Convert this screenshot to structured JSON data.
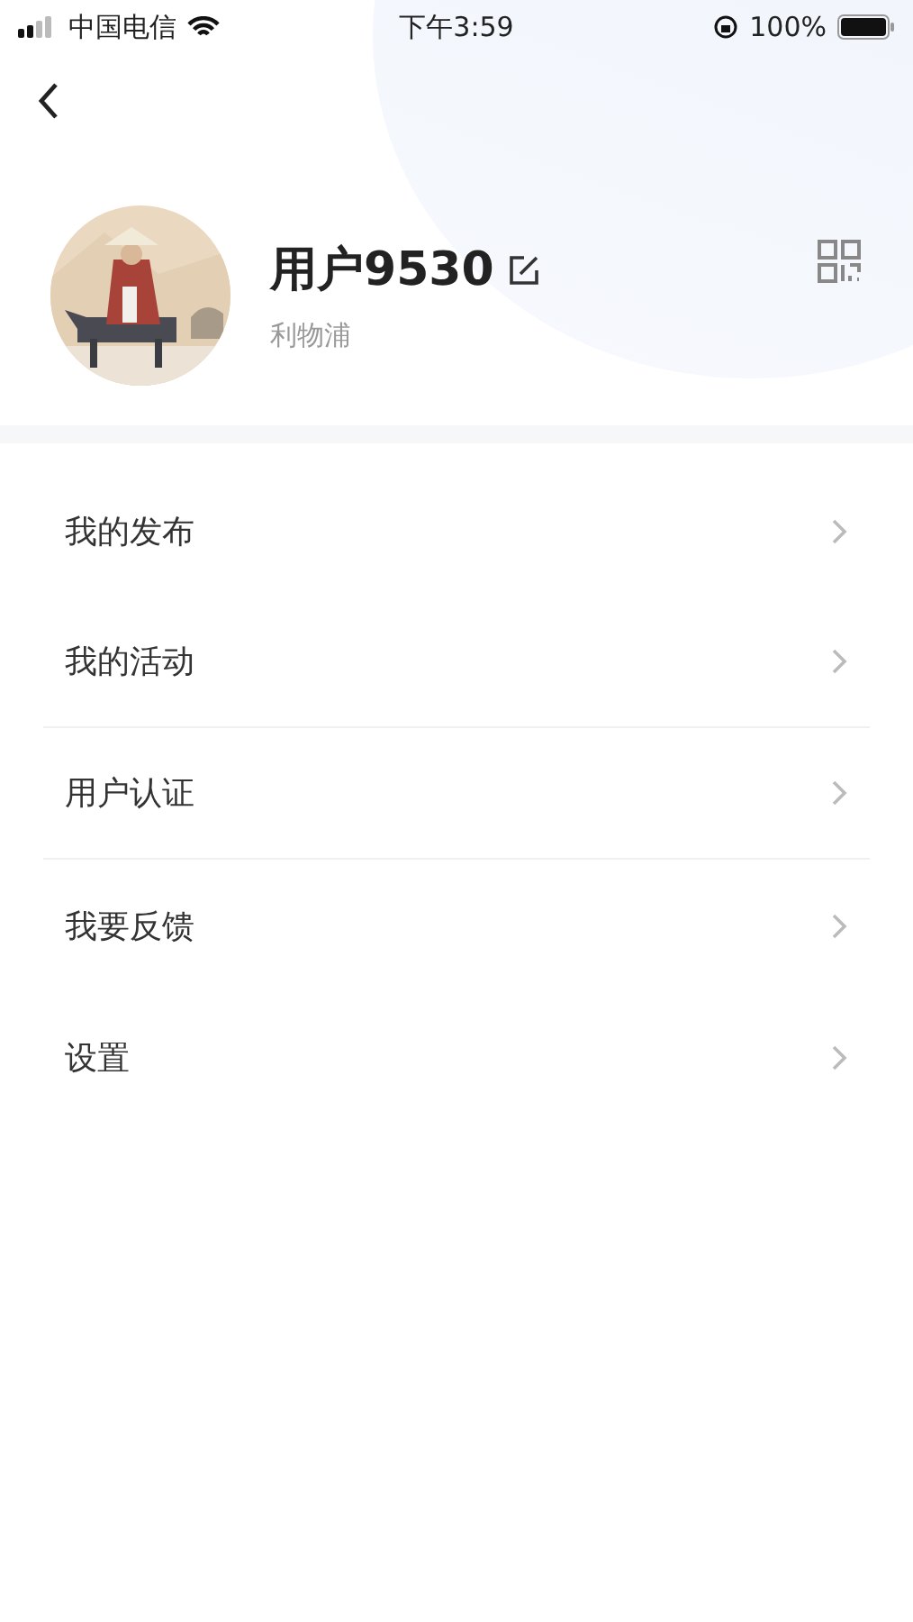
{
  "status_bar": {
    "carrier": "中国电信",
    "time": "下午3:59",
    "battery": "100%"
  },
  "profile": {
    "name": "用户9530",
    "location": "利物浦"
  },
  "menu": [
    {
      "label": "我的发布",
      "divider": false
    },
    {
      "label": "我的活动",
      "divider": true
    },
    {
      "label": "用户认证",
      "divider": true
    },
    {
      "label": "我要反馈",
      "divider": false
    },
    {
      "label": "设置",
      "divider": false
    }
  ]
}
